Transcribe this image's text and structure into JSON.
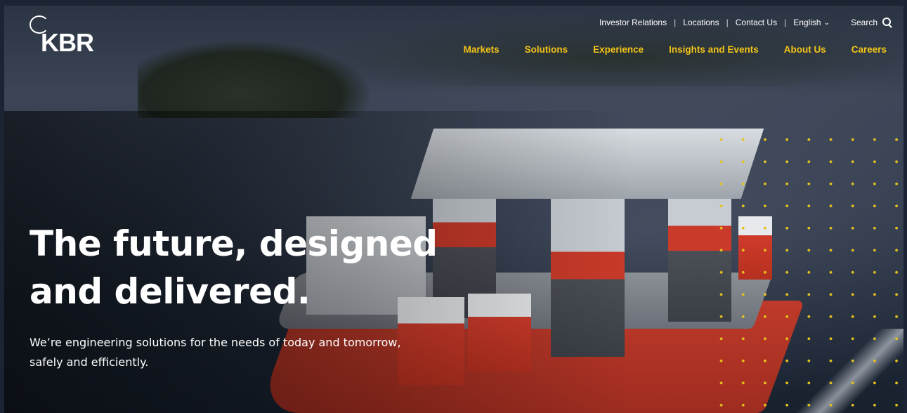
{
  "header": {
    "logo_text": "KBR",
    "utility_nav": [
      {
        "label": "Investor Relations"
      },
      {
        "label": "Locations"
      },
      {
        "label": "Contact Us"
      }
    ],
    "language": {
      "label": "English",
      "icon": "chevron-down-icon"
    },
    "search": {
      "label": "Search",
      "icon": "search-icon"
    }
  },
  "main_nav": [
    {
      "label": "Markets"
    },
    {
      "label": "Solutions"
    },
    {
      "label": "Experience"
    },
    {
      "label": "Insights and Events"
    },
    {
      "label": "About Us"
    },
    {
      "label": "Careers"
    }
  ],
  "hero": {
    "headline_line1": "The future, designed",
    "headline_line2": "and delivered.",
    "subtext_line1": "We’re engineering solutions for the needs of today and tomorrow,",
    "subtext_line2": "safely and efficiently."
  },
  "colors": {
    "nav_accent": "#f2c316",
    "dot_accent": "#e8c21b",
    "text": "#ffffff"
  }
}
